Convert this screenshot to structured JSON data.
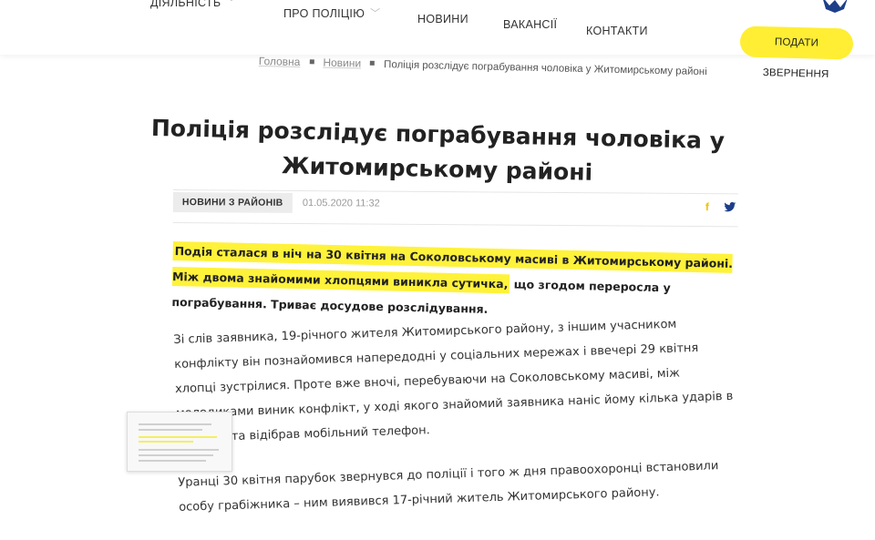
{
  "nav": {
    "items": [
      {
        "label": "ДІЯЛЬНІСТЬ",
        "dropdown": true
      },
      {
        "label": "ПРО ПОЛІЦІЮ",
        "dropdown": true
      },
      {
        "label": "НОВИНИ",
        "dropdown": false
      },
      {
        "label": "ВАКАНСІЇ",
        "dropdown": false
      },
      {
        "label": "КОНТАКТИ",
        "dropdown": false
      }
    ],
    "cta_label": "ПОДАТИ ЗВЕРНЕННЯ"
  },
  "breadcrumb": {
    "home": "Головна",
    "section": "Новини",
    "current": "Поліція розслідує пограбування чоловіка у Житомирському районі"
  },
  "article": {
    "title": "Поліція розслідує пограбування чоловіка у Житомирському районі",
    "category": "НОВИНИ З РАЙОНІВ",
    "date": "01.05.2020 11:32",
    "lead_highlighted": "Подія сталася в ніч на 30 квітня на Соколовському масиві в Житомирському районі. Між двома знайомими хлопцями виникла сутичка,",
    "lead_rest": " що згодом переросла у пограбування. Триває досудове розслідування.",
    "paragraphs": [
      "Зі слів заявника, 19-річного жителя Житомирського району, з іншим учасником конфлікту він познайомився напередодні у соціальних мережах і ввечері 29 квітня хлопці зустрілися. Проте вже вночі, перебуваючи на Соколовському масиві, між молодиками виник конфлікт, у ході якого знайомий заявника наніс йому кілька ударів в обличчя та відібрав мобільний телефон.",
      "Уранці 30 квітня парубок звернувся до поліції і того ж дня правоохоронці встановили особу грабіжника – ним виявився 17-річний житель Житомирського району."
    ]
  },
  "colors": {
    "accent": "#ffee33",
    "highlight": "#fff23a",
    "twitter": "#1d3f8a"
  },
  "icons": {
    "share_facebook": "facebook-icon",
    "share_twitter": "twitter-icon",
    "dropdown": "chevron-down-icon"
  }
}
